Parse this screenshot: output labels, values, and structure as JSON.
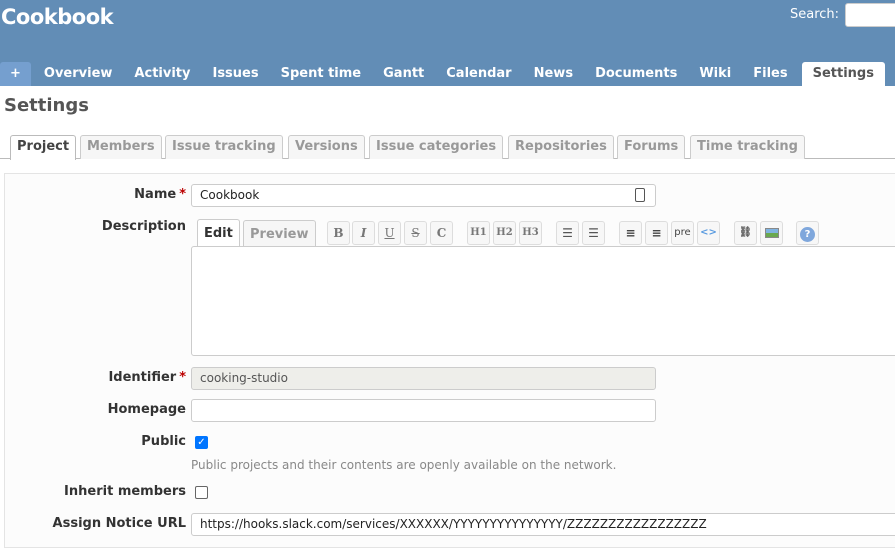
{
  "header": {
    "title": "Cookbook",
    "search_label": "Search:"
  },
  "menu": {
    "plus": "+",
    "items": [
      "Overview",
      "Activity",
      "Issues",
      "Spent time",
      "Gantt",
      "Calendar",
      "News",
      "Documents",
      "Wiki",
      "Files",
      "Settings"
    ],
    "selected": "Settings"
  },
  "page_title": "Settings",
  "tabs": [
    "Project",
    "Members",
    "Issue tracking",
    "Versions",
    "Issue categories",
    "Repositories",
    "Forums",
    "Time tracking"
  ],
  "form": {
    "name_label": "Name",
    "name_value": "Cookbook",
    "description_label": "Description",
    "edit_tab": "Edit",
    "preview_tab": "Preview",
    "toolbar": [
      "B",
      "I",
      "U",
      "S",
      "C",
      "H1",
      "H2",
      "H3",
      "pre"
    ],
    "identifier_label": "Identifier",
    "identifier_value": "cooking-studio",
    "homepage_label": "Homepage",
    "homepage_value": "",
    "public_label": "Public",
    "public_checked": true,
    "public_hint": "Public projects and their contents are openly available on the network.",
    "inherit_label": "Inherit members",
    "inherit_checked": false,
    "notice_label": "Assign Notice URL",
    "notice_value": "https://hooks.slack.com/services/XXXXXX/YYYYYYYYYYYYYYY/ZZZZZZZZZZZZZZZZZ",
    "required_mark": "*"
  },
  "colors": {
    "header": "#628db6",
    "required": "#bb0000",
    "checkbox": "#0075ff"
  }
}
